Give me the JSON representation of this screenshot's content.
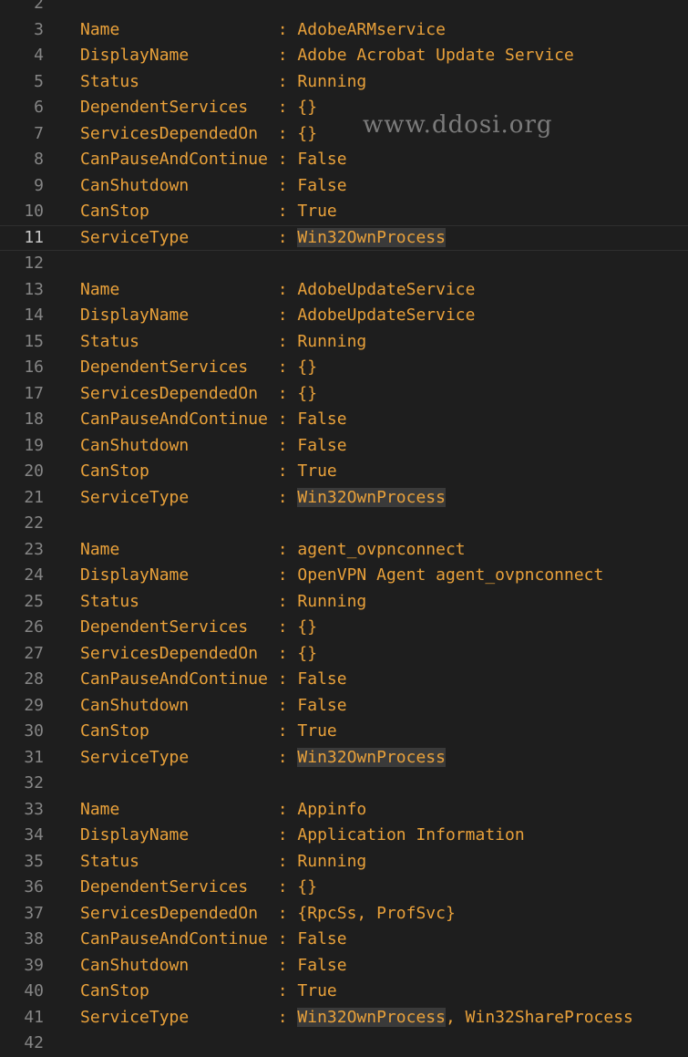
{
  "editor": {
    "current_line": "11",
    "watermark": "www.ddosi.org",
    "lines": [
      {
        "n": "2",
        "text": ""
      },
      {
        "n": "3",
        "text": "Name                : AdobeARMservice"
      },
      {
        "n": "4",
        "text": "DisplayName         : Adobe Acrobat Update Service"
      },
      {
        "n": "5",
        "text": "Status              : Running"
      },
      {
        "n": "6",
        "text": "DependentServices   : {}"
      },
      {
        "n": "7",
        "text": "ServicesDependedOn  : {}"
      },
      {
        "n": "8",
        "text": "CanPauseAndContinue : False"
      },
      {
        "n": "9",
        "text": "CanShutdown         : False"
      },
      {
        "n": "10",
        "text": "CanStop             : True"
      },
      {
        "n": "11",
        "text": "ServiceType         : ",
        "hl": "Win32OwnProcess",
        "rest": ""
      },
      {
        "n": "12",
        "text": ""
      },
      {
        "n": "13",
        "text": "Name                : AdobeUpdateService"
      },
      {
        "n": "14",
        "text": "DisplayName         : AdobeUpdateService"
      },
      {
        "n": "15",
        "text": "Status              : Running"
      },
      {
        "n": "16",
        "text": "DependentServices   : {}"
      },
      {
        "n": "17",
        "text": "ServicesDependedOn  : {}"
      },
      {
        "n": "18",
        "text": "CanPauseAndContinue : False"
      },
      {
        "n": "19",
        "text": "CanShutdown         : False"
      },
      {
        "n": "20",
        "text": "CanStop             : True"
      },
      {
        "n": "21",
        "text": "ServiceType         : ",
        "hl": "Win32OwnProcess",
        "rest": ""
      },
      {
        "n": "22",
        "text": ""
      },
      {
        "n": "23",
        "text": "Name                : agent_ovpnconnect"
      },
      {
        "n": "24",
        "text": "DisplayName         : OpenVPN Agent agent_ovpnconnect"
      },
      {
        "n": "25",
        "text": "Status              : Running"
      },
      {
        "n": "26",
        "text": "DependentServices   : {}"
      },
      {
        "n": "27",
        "text": "ServicesDependedOn  : {}"
      },
      {
        "n": "28",
        "text": "CanPauseAndContinue : False"
      },
      {
        "n": "29",
        "text": "CanShutdown         : False"
      },
      {
        "n": "30",
        "text": "CanStop             : True"
      },
      {
        "n": "31",
        "text": "ServiceType         : ",
        "hl": "Win32OwnProcess",
        "rest": ""
      },
      {
        "n": "32",
        "text": ""
      },
      {
        "n": "33",
        "text": "Name                : Appinfo"
      },
      {
        "n": "34",
        "text": "DisplayName         : Application Information"
      },
      {
        "n": "35",
        "text": "Status              : Running"
      },
      {
        "n": "36",
        "text": "DependentServices   : {}"
      },
      {
        "n": "37",
        "text": "ServicesDependedOn  : {RpcSs, ProfSvc}"
      },
      {
        "n": "38",
        "text": "CanPauseAndContinue : False"
      },
      {
        "n": "39",
        "text": "CanShutdown         : False"
      },
      {
        "n": "40",
        "text": "CanStop             : True"
      },
      {
        "n": "41",
        "text": "ServiceType         : ",
        "hl": "Win32OwnProcess",
        "rest": ", Win32ShareProcess"
      },
      {
        "n": "42",
        "text": ""
      }
    ]
  }
}
